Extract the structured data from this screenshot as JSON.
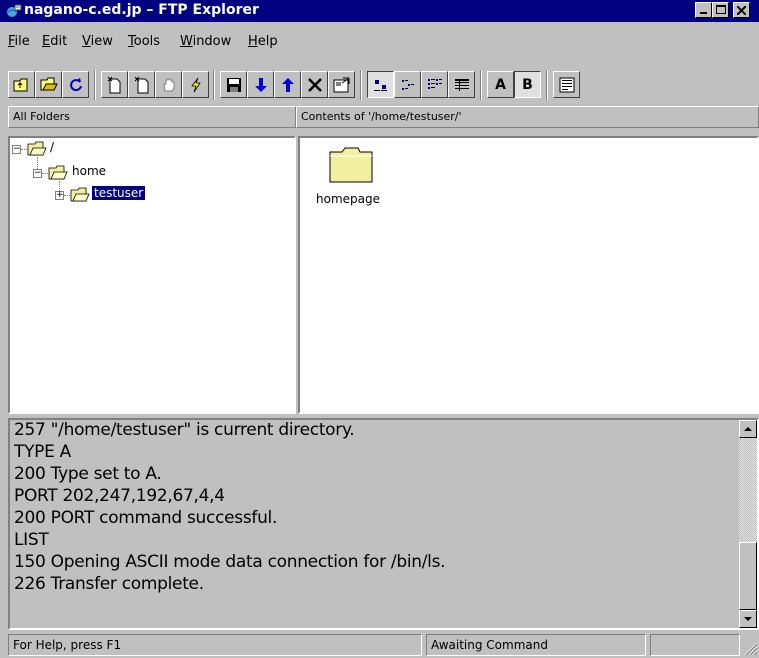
{
  "window": {
    "title": "nagano-c.ed.jp – FTP Explorer",
    "controls": {
      "minimize": "_",
      "maximize": "□",
      "close": "✕"
    }
  },
  "menu": {
    "items": [
      {
        "label": "File",
        "accel": "F",
        "rest": "ile"
      },
      {
        "label": "Edit",
        "accel": "E",
        "rest": "dit"
      },
      {
        "label": "View",
        "accel": "V",
        "rest": "iew"
      },
      {
        "label": "Tools",
        "accel": "T",
        "rest": "ools"
      },
      {
        "label": "Window",
        "accel": "W",
        "rest": "indow"
      },
      {
        "label": "Help",
        "accel": "H",
        "rest": "elp"
      }
    ]
  },
  "toolbar": {
    "bold_a": "A",
    "bold_b": "B"
  },
  "panes": {
    "left_header": "All Folders",
    "right_header": "Contents of '/home/testuser/'"
  },
  "tree": {
    "root": "/",
    "home": "home",
    "testuser": "testuser"
  },
  "contents": {
    "items": [
      {
        "name": "homepage",
        "icon": "folder-icon"
      }
    ]
  },
  "log": {
    "lines": [
      "257 \"/home/testuser\" is current directory.",
      "TYPE A",
      "200 Type set to A.",
      "PORT 202,247,192,67,4,4",
      "200 PORT command successful.",
      "LIST",
      "150 Opening ASCII mode data connection for /bin/ls.",
      "226 Transfer complete."
    ]
  },
  "status": {
    "help": "For Help, press F1",
    "state": "Awaiting Command",
    "extra": ""
  },
  "colors": {
    "titlebar": "#000080",
    "selection": "#000080",
    "folder": "#f0f0a0"
  }
}
